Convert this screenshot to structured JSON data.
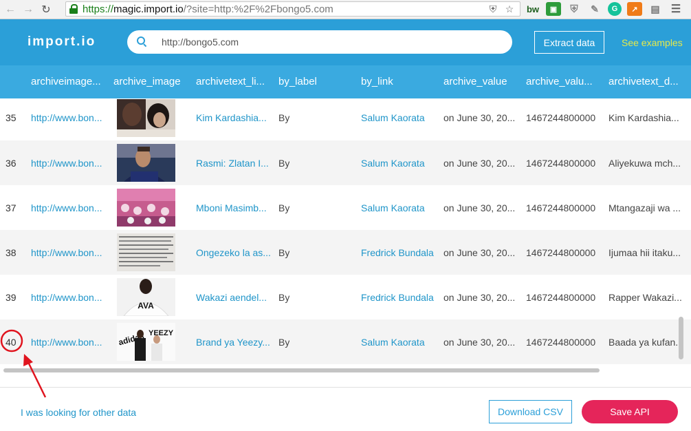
{
  "browser": {
    "url_scheme": "https://",
    "url_host": "magic.import.io",
    "url_path": "/?site=http:%2F%2Fbongo5.com",
    "ext_bw": "bw"
  },
  "header": {
    "logo": "import.io",
    "search_value": "http://bongo5.com",
    "extract_label": "Extract data",
    "examples_label": "See examples"
  },
  "columns": [
    "archiveimage...",
    "archive_image",
    "archivetext_li...",
    "by_label",
    "by_link",
    "archive_value",
    "archive_valu...",
    "archivetext_d..."
  ],
  "rows": [
    {
      "num": "35",
      "img_link": "http://www.bon...",
      "text_link": "Kim Kardashia...",
      "by_label": "By",
      "by_link": "Salum Kaorata",
      "archive_value": "on June 30, 20...",
      "archive_value2": "1467244800000",
      "text_d": "Kim Kardashia..."
    },
    {
      "num": "36",
      "img_link": "http://www.bon...",
      "text_link": "Rasmi: Zlatan I...",
      "by_label": "By",
      "by_link": "Salum Kaorata",
      "archive_value": "on June 30, 20...",
      "archive_value2": "1467244800000",
      "text_d": "Aliyekuwa mch..."
    },
    {
      "num": "37",
      "img_link": "http://www.bon...",
      "text_link": "Mboni Masimb...",
      "by_label": "By",
      "by_link": "Salum Kaorata",
      "archive_value": "on June 30, 20...",
      "archive_value2": "1467244800000",
      "text_d": "Mtangazaji wa ..."
    },
    {
      "num": "38",
      "img_link": "http://www.bon...",
      "text_link": "Ongezeko la as...",
      "by_label": "By",
      "by_link": "Fredrick Bundala",
      "archive_value": "on June 30, 20...",
      "archive_value2": "1467244800000",
      "text_d": "Ijumaa hii itaku..."
    },
    {
      "num": "39",
      "img_link": "http://www.bon...",
      "text_link": "Wakazi aendel...",
      "by_label": "By",
      "by_link": "Fredrick Bundala",
      "archive_value": "on June 30, 20...",
      "archive_value2": "1467244800000",
      "text_d": "Rapper Wakazi..."
    },
    {
      "num": "40",
      "img_link": "http://www.bon...",
      "text_link": "Brand ya Yeezy...",
      "by_label": "By",
      "by_link": "Salum Kaorata",
      "archive_value": "on June 30, 20...",
      "archive_value2": "1467244800000",
      "text_d": "Baada ya kufan..."
    }
  ],
  "thumb_text": {
    "ava": "AVA",
    "adidas": "adidas",
    "yeezy": "YEEZY"
  },
  "footer": {
    "other_data_label": "I was looking for other data",
    "download_csv_label": "Download CSV",
    "save_api_label": "Save API"
  },
  "colors": {
    "header_blue": "#2b9fd8",
    "table_header_blue": "#3aaae0",
    "link_blue": "#1f95c9",
    "save_api_red": "#e5255a",
    "annotation_red": "#e0141e"
  }
}
